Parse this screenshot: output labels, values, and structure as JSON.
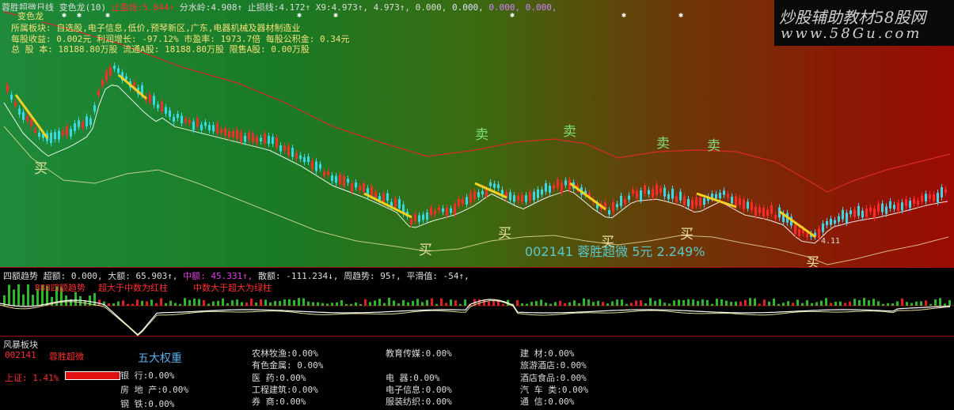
{
  "header": {
    "title": "蓉胜超微日线",
    "indicator_name": "变色龙(10)",
    "stop_loss_label": "止盈线:",
    "stop_loss_value": "5.844↑",
    "divide_label": "分水岭:",
    "divide_value": "4.908↑",
    "stoploss2_label": "止损线:",
    "stoploss2_value": "4.172↑",
    "x9_label": "X9:",
    "x9_value": "4.973↑",
    "v1": "4.973↑",
    "v2": "0.000,",
    "v3": "0.000,",
    "v4": "0.000,",
    "v5": "0.000,"
  },
  "chameleon_label": "变色龙",
  "info": {
    "sector_line": "所属板块: 自选股,电子信息,低价,预琴新区,广东,电器机械及器材制造业",
    "eps_line": "每股收益: 0.002元   利润增长: -97.12%   市盈率: 1973.7倍   每股公积金: 0.34元",
    "capital_line": "总 股 本: 18188.80万股  流通A股: 18188.80万股   限售A股: 0.00万股"
  },
  "watermark": {
    "title": "炒股辅助教材58股网",
    "url": "www.58Gu.com"
  },
  "signals": {
    "sell": "卖",
    "buy": "买",
    "low_price_label": "4.11"
  },
  "stock_summary": "002141  蓉胜超微 5元 2.249%",
  "oscillator": {
    "title": "四额趋势",
    "super_label": "超额: 0.000,",
    "big_label": "大额: 65.903↑,",
    "mid_label": "中额: 45.331↑,",
    "small_label": "散额: -111.234↓,",
    "week_label": "周趋势: 95↑,",
    "smooth_label": "平滑值: -54↑,",
    "legend1": "888四额趋势",
    "legend2": "超大于中数为红柱",
    "legend3": "中数大于超大为绿柱"
  },
  "bottom": {
    "title": "风暴板块",
    "code": "002141",
    "name": "蓉胜超微",
    "index_label": "上证: 1.41%",
    "weight_title": "五大权重",
    "col1": [
      "银    行:0.00%",
      "房 地 产:0.00%",
      "钢    铁:0.00%"
    ],
    "col2": [
      "农林牧渔:0.00%",
      "有色金属: 0.00%",
      "医    药:0.00%",
      "工程建筑:0.00%",
      "券    商:0.00%"
    ],
    "col3": [
      "教育传媒:0.00%",
      "电    器:0.00%",
      "电子信息:0.00%",
      "服装纺织:0.00%"
    ],
    "col4": [
      "建    材:0.00%",
      "旅游酒店:0.00%",
      "酒店食品:0.00%",
      "汽 车 类:0.00%",
      "通    信:0.00%"
    ]
  },
  "colors": {
    "red": "#ff2a2a",
    "green": "#2bd12b",
    "cyan": "#38d8e8",
    "yellow": "#f5e07a",
    "magenta": "#e040e0"
  }
}
